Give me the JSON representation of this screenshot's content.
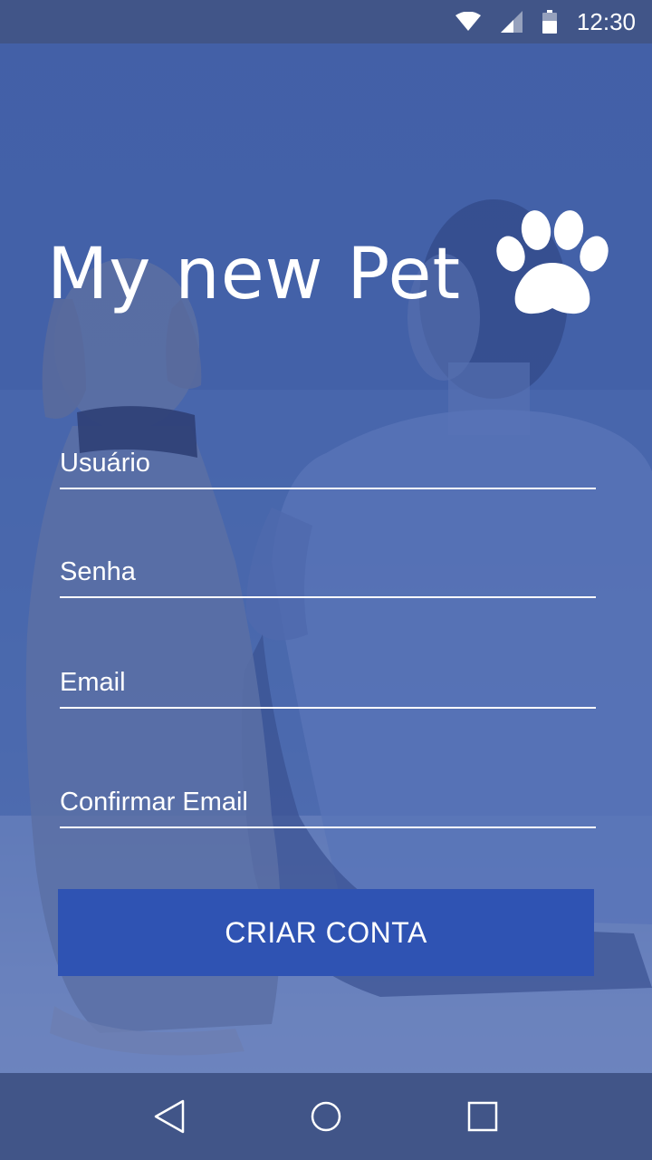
{
  "status_bar": {
    "time": "12:30",
    "icons": [
      "wifi-icon",
      "cell-signal-icon",
      "battery-icon"
    ]
  },
  "app": {
    "title": "My new Pet",
    "logo_icon": "paw-icon"
  },
  "form": {
    "username_placeholder": "Usuário",
    "password_placeholder": "Senha",
    "email_placeholder": "Email",
    "confirm_email_placeholder": "Confirmar Email",
    "submit_label": "CRIAR CONTA"
  },
  "nav_bar": {
    "buttons": [
      "back-icon",
      "home-icon",
      "recents-icon"
    ]
  },
  "colors": {
    "accent": "#2f53b3",
    "bars": "#415588",
    "text": "#ffffff"
  }
}
